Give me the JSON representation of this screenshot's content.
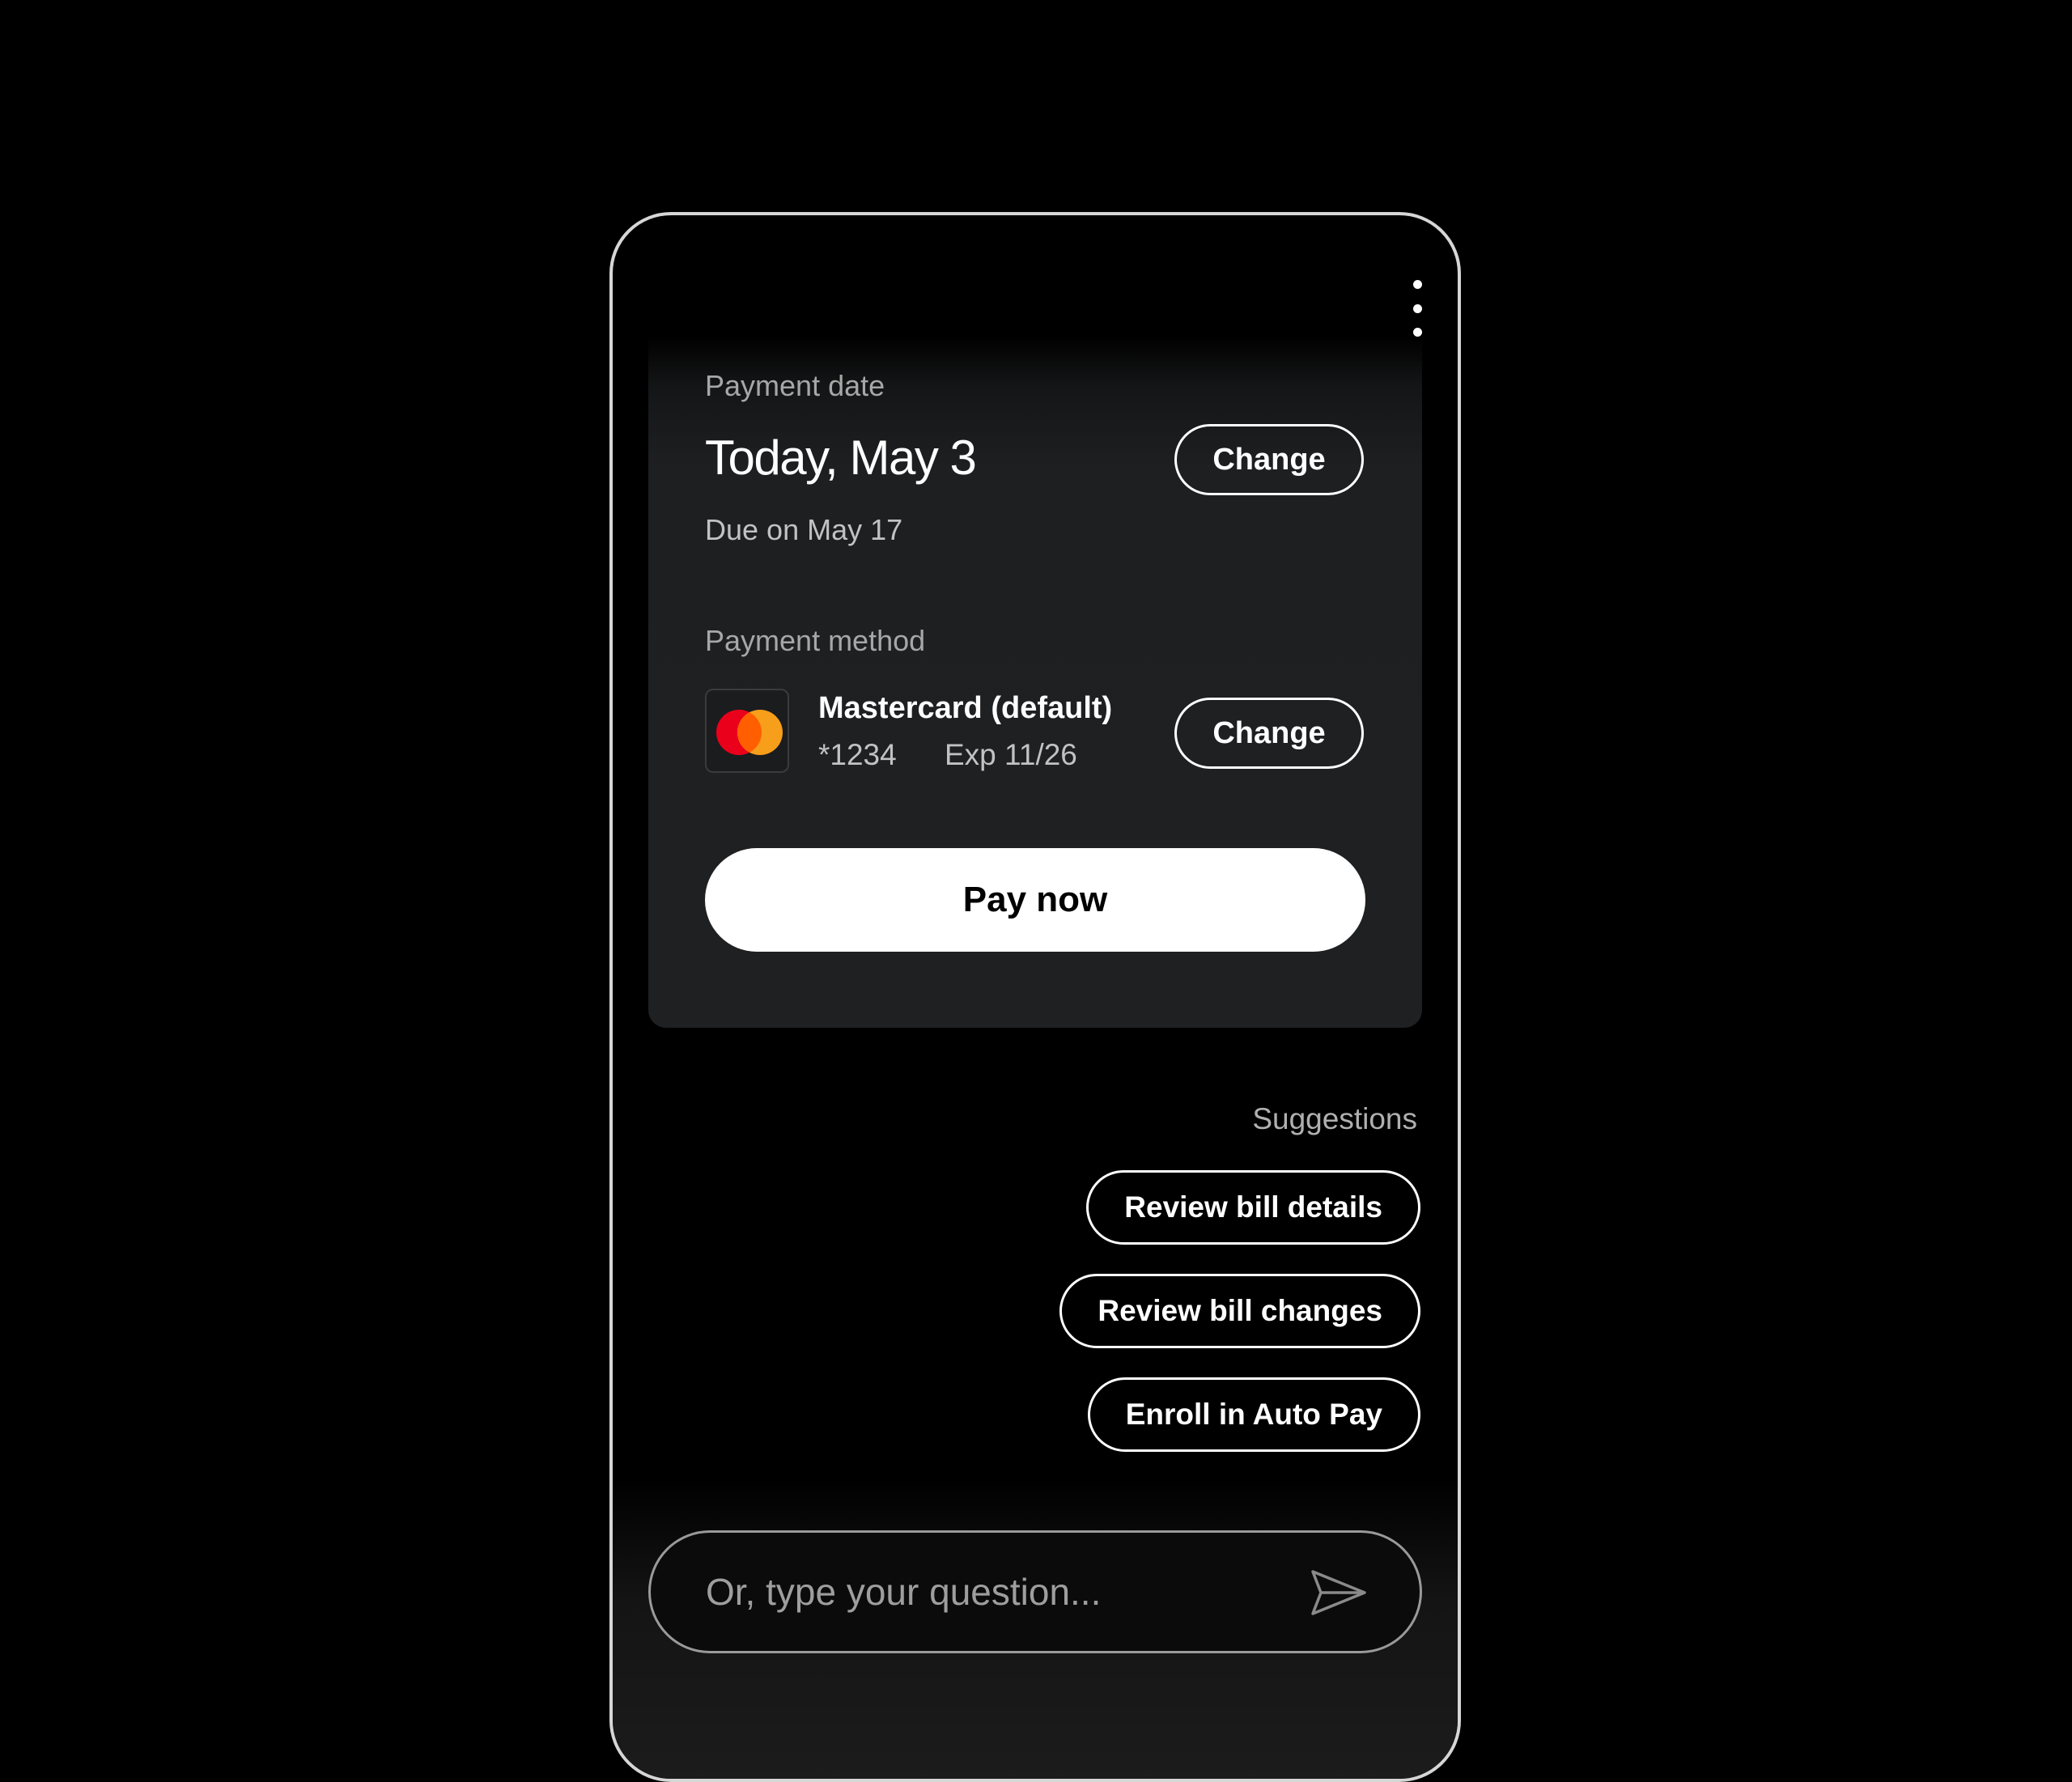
{
  "payment_date": {
    "label": "Payment date",
    "value": "Today, May 3",
    "due": "Due on May 17",
    "change_label": "Change"
  },
  "payment_method": {
    "label": "Payment method",
    "card_name": "Mastercard (default)",
    "card_number": "*1234",
    "card_expiry": "Exp 11/26",
    "change_label": "Change",
    "card_icon": "mastercard-logo",
    "colors": {
      "red": "#eb001b",
      "orange": "#f79e1b"
    }
  },
  "pay_now_label": "Pay now",
  "suggestions": {
    "label": "Suggestions",
    "items": [
      "Review bill details",
      "Review bill changes",
      "Enroll in Auto Pay"
    ]
  },
  "chat_input": {
    "placeholder": "Or, type your question...",
    "send_icon": "send-icon"
  },
  "menu_icon": "more-vertical-icon"
}
